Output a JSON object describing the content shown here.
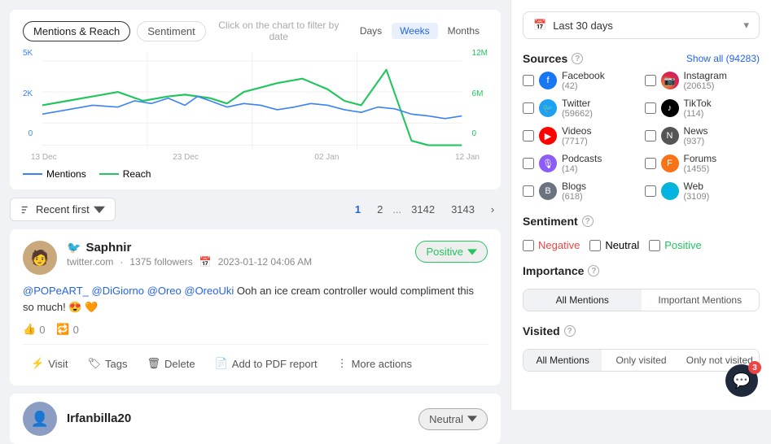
{
  "chart": {
    "tabs": [
      "Mentions & Reach",
      "Sentiment"
    ],
    "active_tab": "Mentions & Reach",
    "hint": "Click on the chart to filter by date",
    "time_tabs": [
      "Days",
      "Weeks",
      "Months"
    ],
    "active_time_tab": "Weeks",
    "x_labels": [
      "13 Dec",
      "23 Dec",
      "02 Jan",
      "12 Jan"
    ],
    "y_left_labels": [
      "5K",
      "2K",
      "0"
    ],
    "y_right_labels": [
      "12M",
      "6M",
      "0"
    ],
    "legend": [
      {
        "label": "Mentions",
        "color": "#3b82f6"
      },
      {
        "label": "Reach",
        "color": "#22c55e"
      }
    ]
  },
  "list_controls": {
    "sort_label": "Recent first",
    "pagination": [
      "1",
      "2",
      "...",
      "3142",
      "3143"
    ]
  },
  "post": {
    "author": "Saphnir",
    "platform": "twitter",
    "source": "twitter.com",
    "followers": "1375 followers",
    "date": "2023-01-12 04:06 AM",
    "sentiment": "Positive",
    "text": "@POPeART_ @DiGiorno @Oreo @OreoUki Ooh an ice cream controller would compliment this so much! 😍 🧡",
    "likes": "0",
    "retweets": "0",
    "actions": [
      "Visit",
      "Tags",
      "Delete",
      "Add to PDF report",
      "More actions"
    ]
  },
  "second_post": {
    "author": "Irfanbilla20",
    "sentiment": "Neutral"
  },
  "right_panel": {
    "date_filter": "Last 30 days",
    "sources_title": "Sources",
    "show_all_label": "Show all",
    "show_all_count": "(94283)",
    "sources": [
      {
        "name": "Facebook",
        "count": "(42)",
        "icon": "f",
        "type": "facebook"
      },
      {
        "name": "Instagram",
        "count": "(20615)",
        "icon": "📷",
        "type": "instagram"
      },
      {
        "name": "Twitter",
        "count": "(59662)",
        "icon": "t",
        "type": "twitter"
      },
      {
        "name": "TikTok",
        "count": "(114)",
        "icon": "♪",
        "type": "tiktok"
      },
      {
        "name": "Videos",
        "count": "(7717)",
        "icon": "▶",
        "type": "videos"
      },
      {
        "name": "News",
        "count": "(937)",
        "icon": "N",
        "type": "news"
      },
      {
        "name": "Podcasts",
        "count": "(14)",
        "icon": "🎙",
        "type": "podcasts"
      },
      {
        "name": "Forums",
        "count": "(1455)",
        "icon": "F",
        "type": "forums"
      },
      {
        "name": "Blogs",
        "count": "(618)",
        "icon": "B",
        "type": "blogs"
      },
      {
        "name": "Web",
        "count": "(3109)",
        "icon": "🌐",
        "type": "web"
      }
    ],
    "sentiment_title": "Sentiment",
    "sentiment_options": [
      "Negative",
      "Neutral",
      "Positive"
    ],
    "importance_title": "Importance",
    "importance_options": [
      "All Mentions",
      "Important Mentions"
    ],
    "importance_active": "All Mentions",
    "visited_title": "Visited",
    "visited_options": [
      "All Mentions",
      "Only visited",
      "Only not visited"
    ],
    "visited_active": "All Mentions",
    "chat_badge": "3"
  }
}
